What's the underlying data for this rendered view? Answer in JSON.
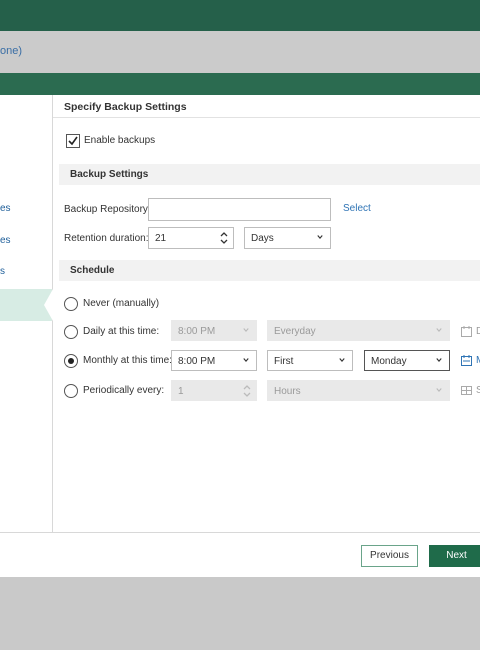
{
  "app": {
    "breadcrumb": "one)"
  },
  "sidebar": {
    "items": [
      {
        "label": "es"
      },
      {
        "label": "es"
      },
      {
        "label": "s"
      }
    ]
  },
  "page": {
    "title": "Specify Backup Settings"
  },
  "enable_backups": {
    "label": "Enable backups",
    "checked": true
  },
  "backup_settings": {
    "header": "Backup Settings",
    "repository": {
      "label": "Backup Repository:",
      "value": "",
      "action": "Select"
    },
    "retention": {
      "label": "Retention duration:",
      "value": "21",
      "unit": "Days"
    }
  },
  "schedule": {
    "header": "Schedule",
    "never": {
      "label": "Never (manually)",
      "selected": false
    },
    "daily": {
      "label": "Daily at this time:",
      "time": "8:00 PM",
      "frequency": "Everyday",
      "selected": false,
      "trailing": "D"
    },
    "monthly": {
      "label": "Monthly at this time:",
      "time": "8:00 PM",
      "week": "First",
      "day": "Monday",
      "selected": true,
      "trailing": "M"
    },
    "periodic": {
      "label": "Periodically every:",
      "value": "1",
      "unit": "Hours",
      "selected": false,
      "trailing": "S"
    }
  },
  "footer": {
    "previous": "Previous",
    "next": "Next"
  }
}
